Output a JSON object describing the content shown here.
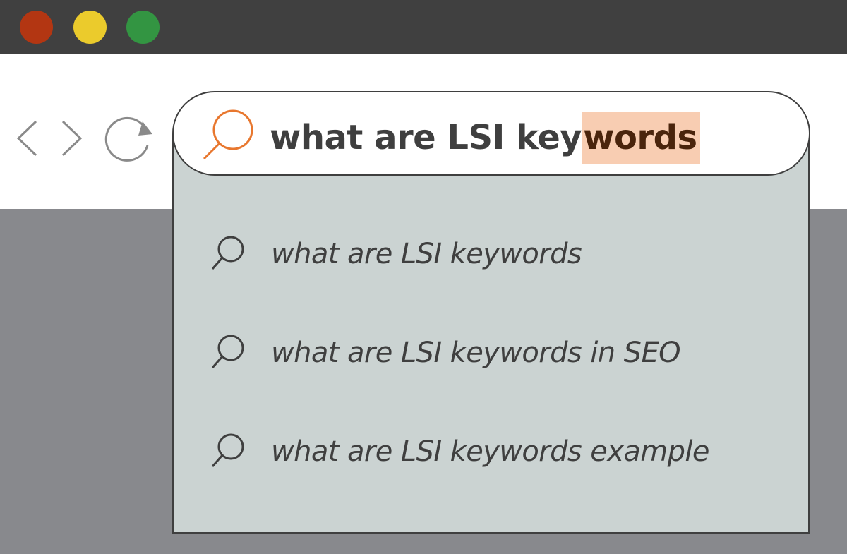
{
  "window": {
    "traffic_lights": [
      {
        "name": "close",
        "color": "#b33612"
      },
      {
        "name": "minimize",
        "color": "#ebcb2c"
      },
      {
        "name": "zoom",
        "color": "#339542"
      }
    ]
  },
  "toolbar": {
    "back_icon": "chevron-left-icon",
    "forward_icon": "chevron-right-icon",
    "reload_icon": "reload-icon"
  },
  "search": {
    "query_typed": "what are LSI key",
    "query_completion": "words",
    "icon": "search-icon",
    "accent_color": "#e8772e",
    "highlight_color": "#f8cdb2"
  },
  "suggestions": [
    {
      "text": "what are LSI keywords",
      "icon": "search-icon"
    },
    {
      "text": "what are LSI keywords in SEO",
      "icon": "search-icon"
    },
    {
      "text": "what are LSI keywords example",
      "icon": "search-icon"
    }
  ]
}
